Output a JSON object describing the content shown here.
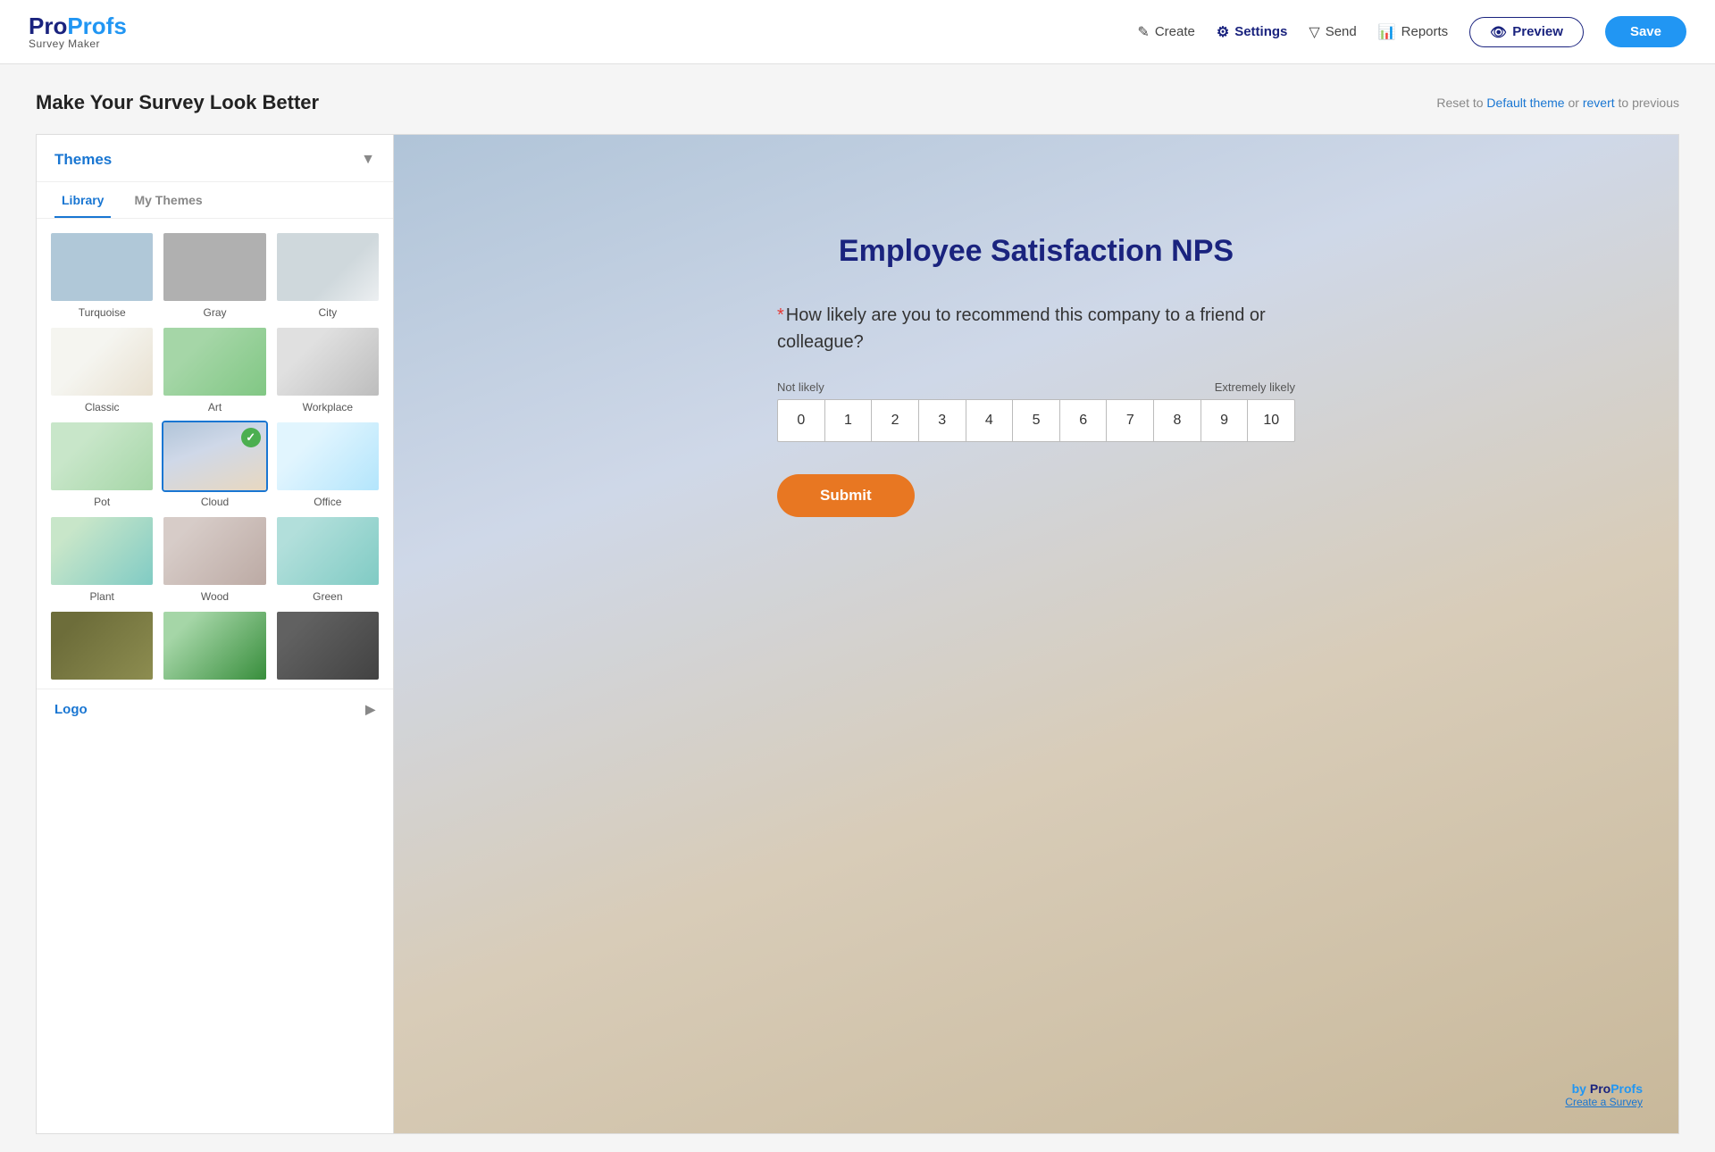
{
  "header": {
    "logo_pro": "Pro",
    "logo_profs": "Profs",
    "logo_sub": "Survey Maker",
    "nav": [
      {
        "id": "create",
        "label": "Create",
        "icon": "✎",
        "active": false
      },
      {
        "id": "settings",
        "label": "Settings",
        "icon": "⚙",
        "active": true
      },
      {
        "id": "send",
        "label": "Send",
        "icon": "▽",
        "active": false
      },
      {
        "id": "reports",
        "label": "Reports",
        "icon": "📊",
        "active": false
      }
    ],
    "preview_label": "Preview",
    "save_label": "Save"
  },
  "page": {
    "title": "Make Your Survey Look Better",
    "reset_text": "Reset to",
    "reset_link": "Default theme",
    "reset_or": " or ",
    "revert_link": "revert",
    "revert_suffix": " to previous"
  },
  "sidebar": {
    "title": "Themes",
    "arrow": "▼",
    "tab_library": "Library",
    "tab_my_themes": "My Themes",
    "themes": [
      {
        "id": "turquoise",
        "label": "Turquoise",
        "bg_class": "bg-turquoise",
        "selected": false
      },
      {
        "id": "gray",
        "label": "Gray",
        "bg_class": "bg-gray",
        "selected": false
      },
      {
        "id": "city",
        "label": "City",
        "bg_class": "bg-city",
        "selected": false
      },
      {
        "id": "classic",
        "label": "Classic",
        "bg_class": "bg-classic",
        "selected": false
      },
      {
        "id": "art",
        "label": "Art",
        "bg_class": "bg-art",
        "selected": false
      },
      {
        "id": "workplace",
        "label": "Workplace",
        "bg_class": "bg-workplace",
        "selected": false
      },
      {
        "id": "pot",
        "label": "Pot",
        "bg_class": "bg-pot",
        "selected": false
      },
      {
        "id": "cloud",
        "label": "Cloud",
        "bg_class": "bg-cloud",
        "selected": true
      },
      {
        "id": "office",
        "label": "Office",
        "bg_class": "bg-office",
        "selected": false
      },
      {
        "id": "plant",
        "label": "Plant",
        "bg_class": "bg-plant",
        "selected": false
      },
      {
        "id": "wood",
        "label": "Wood",
        "bg_class": "bg-wood",
        "selected": false
      },
      {
        "id": "green",
        "label": "Green",
        "bg_class": "bg-green",
        "selected": false
      },
      {
        "id": "olive",
        "label": "",
        "bg_class": "bg-olive",
        "selected": false
      },
      {
        "id": "leaf",
        "label": "",
        "bg_class": "bg-leaf",
        "selected": false
      },
      {
        "id": "darkgray",
        "label": "",
        "bg_class": "bg-darkgray",
        "selected": false
      }
    ],
    "logo_section": "Logo",
    "logo_arrow": "▶"
  },
  "survey": {
    "title": "Employee Satisfaction NPS",
    "question": "How likely are you to recommend this company to a friend or colleague?",
    "required": true,
    "scale_start_label": "Not likely",
    "scale_end_label": "Extremely likely",
    "scale_values": [
      "0",
      "1",
      "2",
      "3",
      "4",
      "5",
      "6",
      "7",
      "8",
      "9",
      "10"
    ],
    "submit_label": "Submit"
  },
  "powered": {
    "by_text": "by",
    "pro": "Pro",
    "profs": "Profs",
    "create_link": "Create a Survey"
  }
}
